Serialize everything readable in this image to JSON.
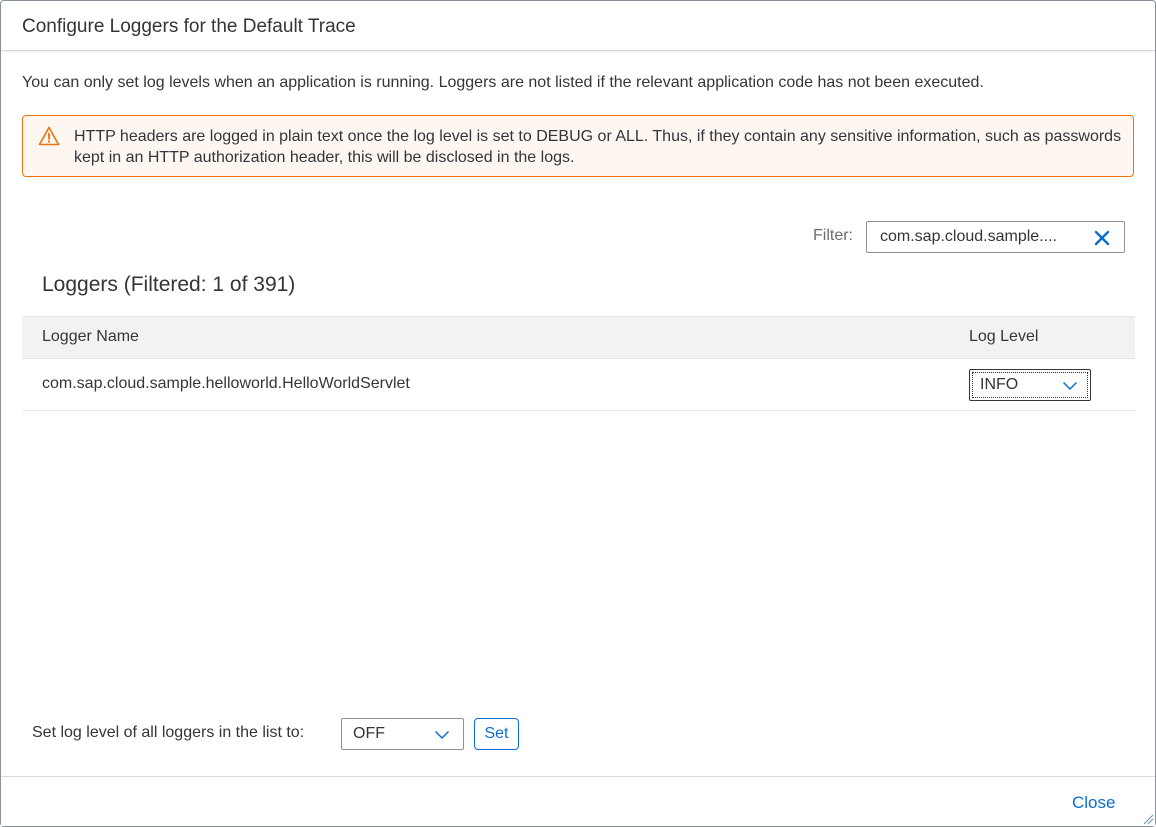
{
  "dialog": {
    "title": "Configure Loggers for the Default Trace",
    "info_text": "You can only set log levels when an application is running. Loggers are not listed if the relevant application code has not been executed.",
    "warning": {
      "icon": "warning-triangle-icon",
      "text": "HTTP headers are logged in plain text once the log level is set to DEBUG or ALL. Thus, if they contain any sensitive information, such as passwords kept in an HTTP authorization header, this will be disclosed in the logs."
    },
    "filter": {
      "label": "Filter:",
      "value": "com.sap.cloud.sample....",
      "clear_icon": "close-icon"
    },
    "table": {
      "title": "Loggers (Filtered: 1 of 391)",
      "columns": [
        "Logger Name",
        "Log Level"
      ],
      "rows": [
        {
          "name": "com.sap.cloud.sample.helloworld.HelloWorldServlet",
          "level": "INFO"
        }
      ]
    },
    "bulk": {
      "label": "Set log level of all loggers in the list to:",
      "value": "OFF",
      "set_label": "Set"
    },
    "footer": {
      "close_label": "Close"
    },
    "colors": {
      "accent": "#0a6ed1",
      "warning_border": "#e9730c",
      "warning_bg": "#fef7f1",
      "text": "#32363a"
    }
  }
}
